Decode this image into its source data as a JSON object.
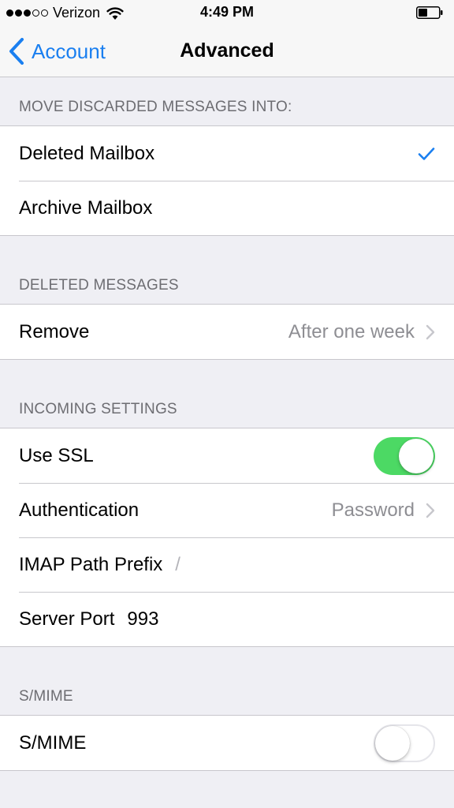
{
  "status_bar": {
    "carrier": "Verizon",
    "time": "4:49 PM",
    "signal_bars_filled": 3,
    "signal_bars_total": 5
  },
  "nav": {
    "back_label": "Account",
    "title": "Advanced"
  },
  "sections": {
    "discarded": {
      "header": "MOVE DISCARDED MESSAGES INTO:",
      "items": [
        {
          "label": "Deleted Mailbox",
          "selected": true
        },
        {
          "label": "Archive Mailbox",
          "selected": false
        }
      ]
    },
    "deleted": {
      "header": "DELETED MESSAGES",
      "remove_label": "Remove",
      "remove_value": "After one week"
    },
    "incoming": {
      "header": "INCOMING SETTINGS",
      "ssl_label": "Use SSL",
      "ssl_on": true,
      "auth_label": "Authentication",
      "auth_value": "Password",
      "imap_label": "IMAP Path Prefix",
      "imap_value": "/",
      "port_label": "Server Port",
      "port_value": "993"
    },
    "smime": {
      "header": "S/MIME",
      "label": "S/MIME",
      "on": false
    }
  },
  "colors": {
    "accent": "#1a7ff0",
    "toggle_on": "#4cd964",
    "background": "#efeff4"
  }
}
